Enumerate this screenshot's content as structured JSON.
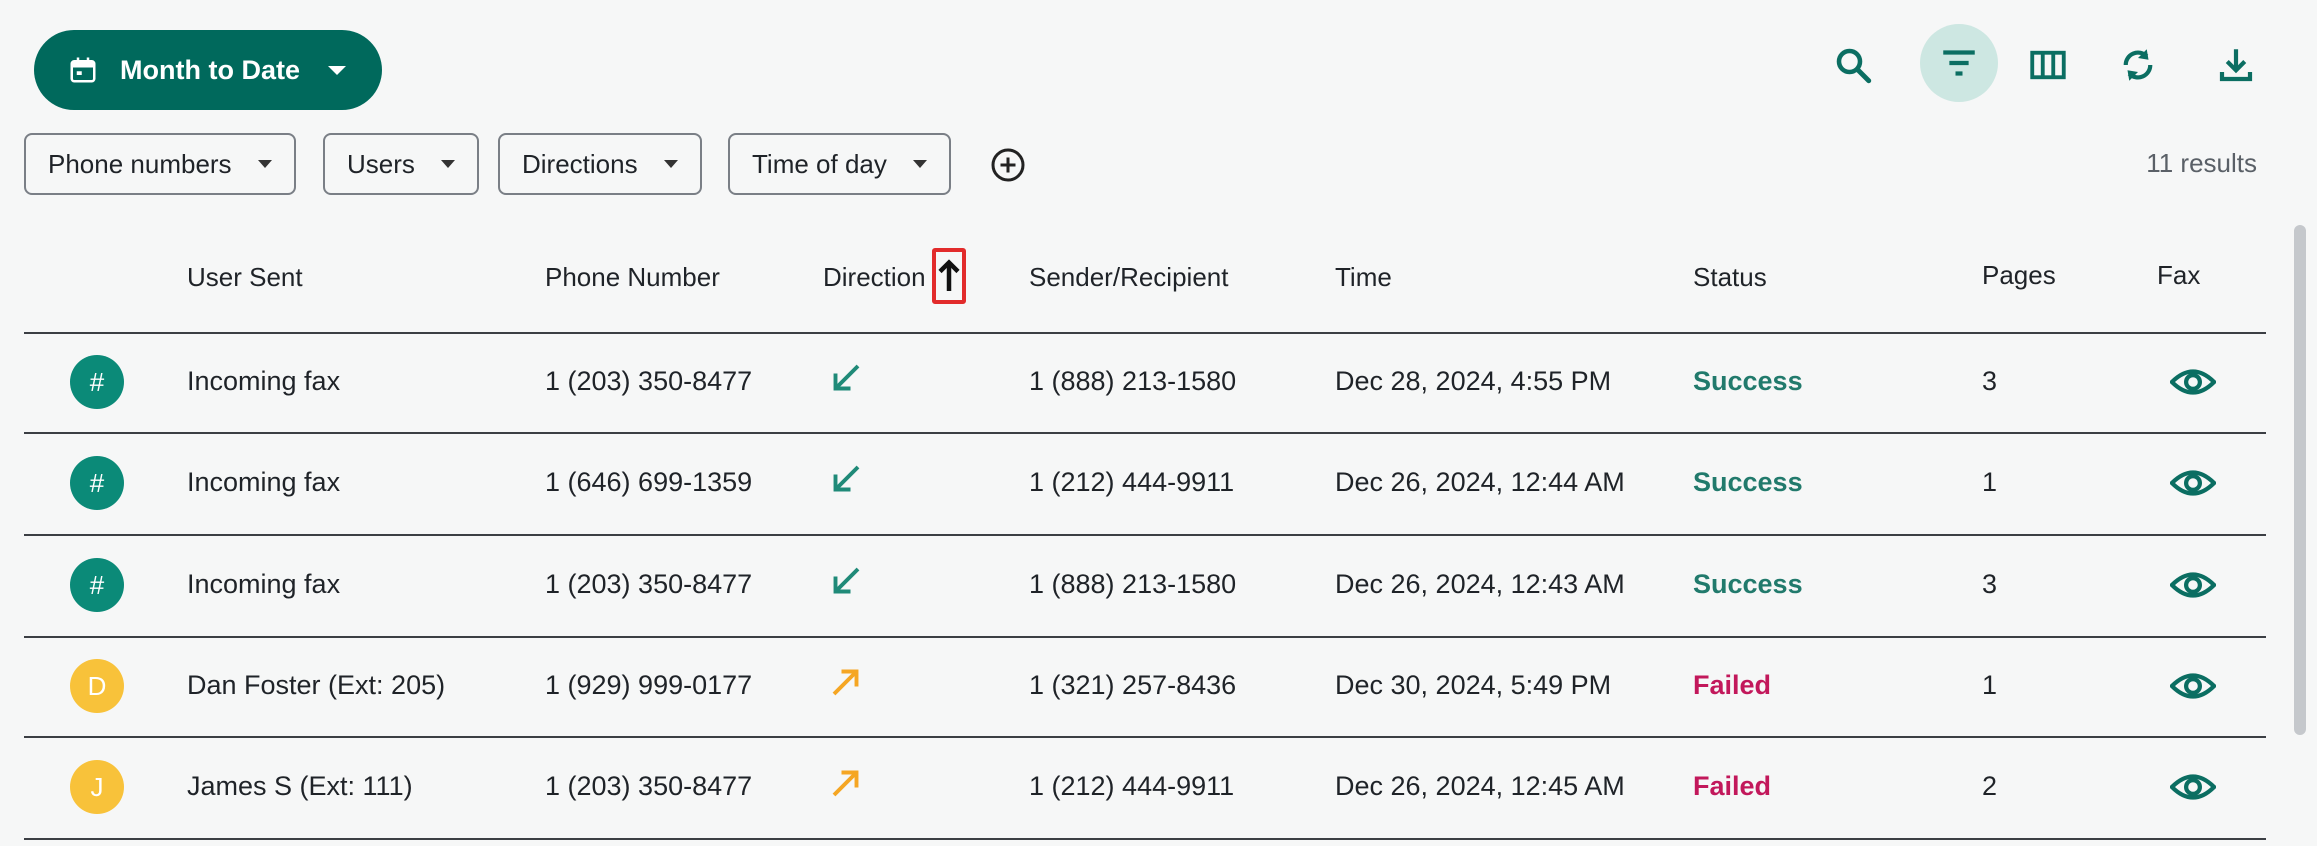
{
  "toolbar": {
    "date_range_label": "Month to Date",
    "icons": [
      "search-icon",
      "filter-icon",
      "columns-icon",
      "refresh-icon",
      "download-icon"
    ]
  },
  "filters": {
    "chips": [
      "Phone numbers",
      "Users",
      "Directions",
      "Time of day"
    ],
    "results_text": "11 results"
  },
  "table": {
    "headers": {
      "user_sent": "User Sent",
      "phone_number": "Phone Number",
      "direction": "Direction",
      "sender_recipient": "Sender/Recipient",
      "time": "Time",
      "status": "Status",
      "pages": "Pages",
      "fax": "Fax"
    },
    "rows": [
      {
        "avatar": "#",
        "avatar_color": "#0b8a78",
        "user": "Incoming fax",
        "phone": "1 (203) 350-8477",
        "direction": "incoming",
        "party": "1 (888) 213-1580",
        "time": "Dec 28, 2024, 4:55 PM",
        "status": "Success",
        "pages": "3"
      },
      {
        "avatar": "#",
        "avatar_color": "#0b8a78",
        "user": "Incoming fax",
        "phone": "1 (646) 699-1359",
        "direction": "incoming",
        "party": "1 (212) 444-9911",
        "time": "Dec 26, 2024, 12:44 AM",
        "status": "Success",
        "pages": "1"
      },
      {
        "avatar": "#",
        "avatar_color": "#0b8a78",
        "user": "Incoming fax",
        "phone": "1 (203) 350-8477",
        "direction": "incoming",
        "party": "1 (888) 213-1580",
        "time": "Dec 26, 2024, 12:43 AM",
        "status": "Success",
        "pages": "3"
      },
      {
        "avatar": "D",
        "avatar_color": "#f8c23a",
        "user": "Dan Foster (Ext: 205)",
        "phone": "1 (929) 999-0177",
        "direction": "outgoing",
        "party": "1 (321) 257-8436",
        "time": "Dec 30, 2024, 5:49 PM",
        "status": "Failed",
        "pages": "1"
      },
      {
        "avatar": "J",
        "avatar_color": "#f8c23a",
        "user": "James S (Ext: 111)",
        "phone": "1 (203) 350-8477",
        "direction": "outgoing",
        "party": "1 (212) 444-9911",
        "time": "Dec 26, 2024, 12:45 AM",
        "status": "Failed",
        "pages": "2"
      }
    ]
  },
  "colors": {
    "accent": "#00695c",
    "success": "#217a6c",
    "failed": "#c2185b",
    "incoming_arrow": "#1f8a78",
    "outgoing_arrow": "#f5a623"
  }
}
